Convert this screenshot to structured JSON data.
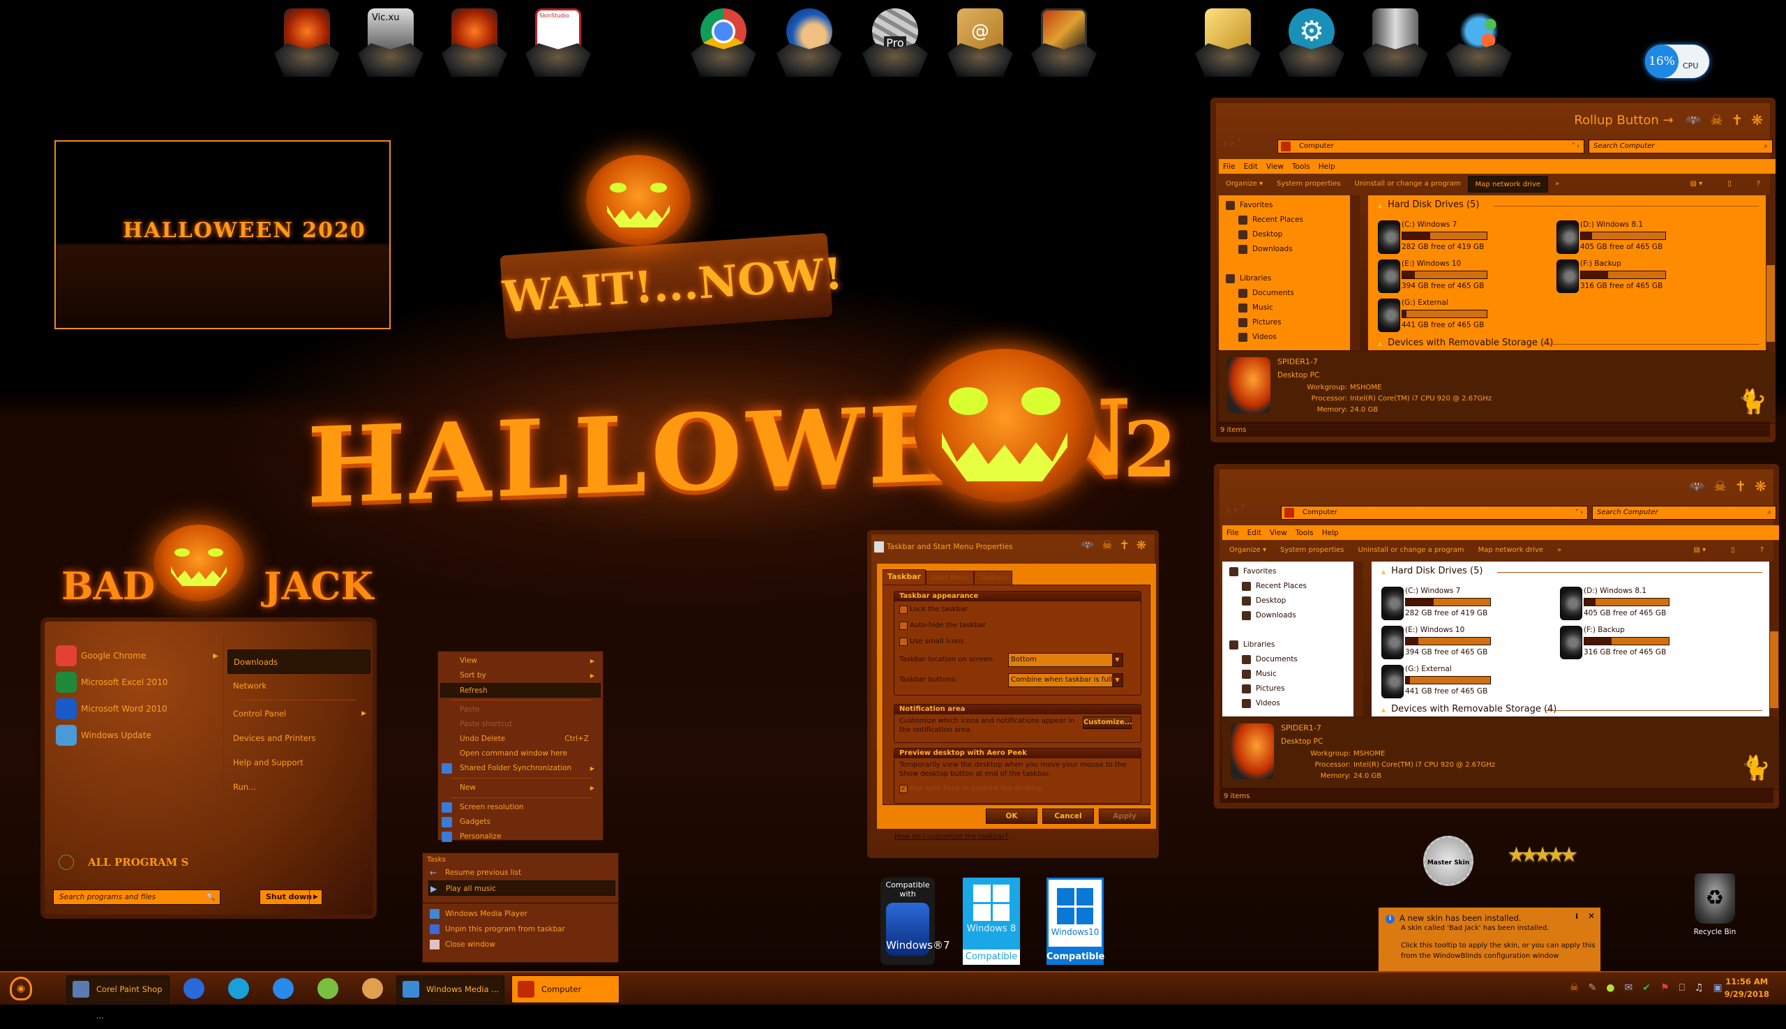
{
  "dock": {
    "left_group": [
      "computer-icon",
      "vic-xu-card-icon",
      "computer-tools-icon",
      "skinstudio-icon"
    ],
    "middle_group": [
      "google-chrome-icon",
      "thunderbird-icon",
      "google-earth-pro-icon",
      "address-book-icon",
      "display-settings-icon"
    ],
    "right_group": [
      "system-settings-folder-icon",
      "update-settings-icon",
      "server-3d-icon",
      "control-panel-icon"
    ],
    "earth_label": "Pro",
    "skinstudio_label": "SkinStudio"
  },
  "cpu_meter": {
    "value": "16%",
    "label": "CPU",
    "percent": 16
  },
  "wallpaper": {
    "preview_title": "HALLOWEEN 2020",
    "big_title": "HALLOWEEN",
    "big_year": "2",
    "sign_text": "WAIT!...NOW!",
    "badjack_left": "BAD",
    "badjack_right": "JACK"
  },
  "start_menu": {
    "programs": [
      {
        "label": "Google Chrome",
        "icon": "chrome-icon",
        "has_submenu": true,
        "color": "#e34133"
      },
      {
        "label": "Microsoft Excel 2010",
        "icon": "excel-icon",
        "has_submenu": false,
        "color": "#1f8a3a"
      },
      {
        "label": "Microsoft Word 2010",
        "icon": "word-icon",
        "has_submenu": false,
        "color": "#1a5ac8"
      },
      {
        "label": "Windows Update",
        "icon": "windows-update-icon",
        "has_submenu": false,
        "color": "#4a9ad8"
      }
    ],
    "places": [
      {
        "label": "Downloads",
        "highlighted": true,
        "has_submenu": false
      },
      {
        "label": "Network",
        "highlighted": false,
        "has_submenu": false
      },
      {
        "label": "Control Panel",
        "highlighted": false,
        "has_submenu": true
      },
      {
        "label": "Devices and Printers",
        "highlighted": false,
        "has_submenu": false
      },
      {
        "label": "Help and Support",
        "highlighted": false,
        "has_submenu": false
      },
      {
        "label": "Run...",
        "highlighted": false,
        "has_submenu": false
      }
    ],
    "all_programs": "ALL PROGRAM S",
    "search_placeholder": "Search programs and files",
    "shutdown_label": "Shut down"
  },
  "context_menu": {
    "items": [
      {
        "label": "View",
        "arrow": true
      },
      {
        "label": "Sort by",
        "arrow": true
      },
      {
        "label": "Refresh",
        "highlighted": true
      },
      {
        "sep": true
      },
      {
        "label": "Paste",
        "disabled": true
      },
      {
        "label": "Paste shortcut",
        "disabled": true
      },
      {
        "label": "Undo Delete",
        "shortcut": "Ctrl+Z"
      },
      {
        "label": "Open command window here"
      },
      {
        "label": "Shared Folder Synchronization",
        "arrow": true,
        "icon": "shared-folder-sync-icon"
      },
      {
        "sep": true
      },
      {
        "label": "New",
        "arrow": true
      },
      {
        "sep": true
      },
      {
        "label": "Screen resolution",
        "icon": "screen-resolution-icon"
      },
      {
        "label": "Gadgets",
        "icon": "gadgets-icon"
      },
      {
        "label": "Personalize",
        "icon": "personalize-icon"
      }
    ]
  },
  "jump_list": {
    "header": "Tasks",
    "tasks": [
      {
        "label": "Resume previous list",
        "icon": "back-arrow-icon"
      },
      {
        "label": "Play all music",
        "icon": "play-icon",
        "highlighted": true
      }
    ],
    "actions": [
      {
        "label": "Windows Media Player",
        "icon": "media-player-icon"
      },
      {
        "label": "Unpin this program from taskbar",
        "icon": "pin-icon"
      },
      {
        "label": "Close window",
        "icon": "close-window-icon"
      }
    ]
  },
  "taskbar_props": {
    "title": "Taskbar and Start Menu Properties",
    "tabs": [
      {
        "label": "Taskbar",
        "active": true
      },
      {
        "label": "Start Menu"
      },
      {
        "label": "Toolbars"
      }
    ],
    "appearance": {
      "header": "Taskbar appearance",
      "lock": {
        "label": "Lock the taskbar",
        "checked": false
      },
      "autohide": {
        "label": "Auto-hide the taskbar",
        "checked": false
      },
      "small_icons": {
        "label": "Use small icons",
        "checked": false
      },
      "location_label": "Taskbar location on screen:",
      "location_value": "Bottom",
      "buttons_label": "Taskbar buttons:",
      "buttons_value": "Combine when taskbar is full"
    },
    "notification": {
      "header": "Notification area",
      "text": "Customize which icons and notifications appear in the notification area.",
      "button": "Customize..."
    },
    "aero_peek": {
      "header": "Preview desktop with Aero Peek",
      "text": "Temporarily view the desktop when you move your mouse to the Show desktop button at end of the taskbar.",
      "checkbox": "Use Aero Peek to preview the desktop",
      "checked": true
    },
    "help_link": "How do I customize the taskbar?",
    "ok": "OK",
    "cancel": "Cancel",
    "apply": "Apply"
  },
  "explorers": [
    {
      "rollup_label": "Rollup Button →",
      "address": "Computer",
      "search_placeholder": "Search Computer",
      "menu": [
        "File",
        "Edit",
        "View",
        "Tools",
        "Help"
      ],
      "commands": [
        "Organize ▾",
        "System properties",
        "Uninstall or change a program",
        "Map network drive",
        "»"
      ],
      "highlighted_command": 3
    },
    {
      "rollup_label": "",
      "address": "Computer",
      "search_placeholder": "Search Computer",
      "menu": [
        "File",
        "Edit",
        "View",
        "Tools",
        "Help"
      ],
      "commands": [
        "Organize ▾",
        "System properties",
        "Uninstall or change a program",
        "Map network drive",
        "»"
      ],
      "highlighted_command": -1
    }
  ],
  "nav_pane": {
    "favorites": "Favorites",
    "favorite_items": [
      "Recent Places",
      "Desktop",
      "Downloads"
    ],
    "libraries": "Libraries",
    "library_items": [
      "Documents",
      "Music",
      "Pictures",
      "Videos"
    ]
  },
  "drives": {
    "section": "Hard Disk Drives (5)",
    "removable_section": "Devices with Removable Storage (4)",
    "items": [
      {
        "name": "(C:) Windows 7",
        "free": "282 GB free of 419 GB",
        "used_fraction": 0.33
      },
      {
        "name": "(D:) Windows 8.1",
        "free": "405 GB free of 465 GB",
        "used_fraction": 0.13
      },
      {
        "name": "(E:) Windows 10",
        "free": "394 GB free of 465 GB",
        "used_fraction": 0.15
      },
      {
        "name": "(F:) Backup",
        "free": "316 GB free of 465 GB",
        "used_fraction": 0.32
      },
      {
        "name": "(G:) External",
        "free": "441 GB free of 465 GB",
        "used_fraction": 0.05
      }
    ]
  },
  "computer_details": {
    "name": "SPIDER1-7",
    "type": "Desktop PC",
    "workgroup_label": "Workgroup:",
    "workgroup": "MSHOME",
    "processor_label": "Processor:",
    "processor": "Intel(R) Core(TM) i7 CPU        920  @ 2.67GHz",
    "memory_label": "Memory:",
    "memory": "24.0 GB",
    "status": "9 items"
  },
  "badges": {
    "win7_top": "Compatible with",
    "win7_name": "Windows®7",
    "win8_name": "Windows 8",
    "win10_name": "Windows10",
    "compatible": "Compatible",
    "master_skin": "Master Skin",
    "stars": "★★★★★"
  },
  "recycle_bin": {
    "label": "Recycle Bin"
  },
  "balloon": {
    "title": "A new skin has been installed.",
    "line1": "A skin called 'Bad Jack' has been installed.",
    "line2": "Click this tooltip to apply the skin, or you can apply this from the WindowBlinds configuration window"
  },
  "taskbar": {
    "buttons": [
      {
        "label": "Corel Paint Shop ...",
        "icon": "corel-paintshop-icon",
        "active": false
      },
      {
        "label": "Windows Media ...",
        "icon": "media-player-icon",
        "active": false
      },
      {
        "label": "Computer",
        "icon": "computer-icon",
        "active": true
      }
    ],
    "pinned": [
      "cursor-app-icon",
      "stack-app-icon",
      "internet-explorer-icon",
      "money-app-icon",
      "home-app-icon"
    ],
    "tray": [
      "skin-tray-icon",
      "paint-tray-icon",
      "lime-tray-icon",
      "mail-tray-icon",
      "green-check-tray-icon",
      "flags-tray-icon",
      "network-tray-icon",
      "volume-tray-icon",
      "monitors-tray-icon"
    ],
    "time": "11:56 AM",
    "date": "9/29/2018"
  }
}
